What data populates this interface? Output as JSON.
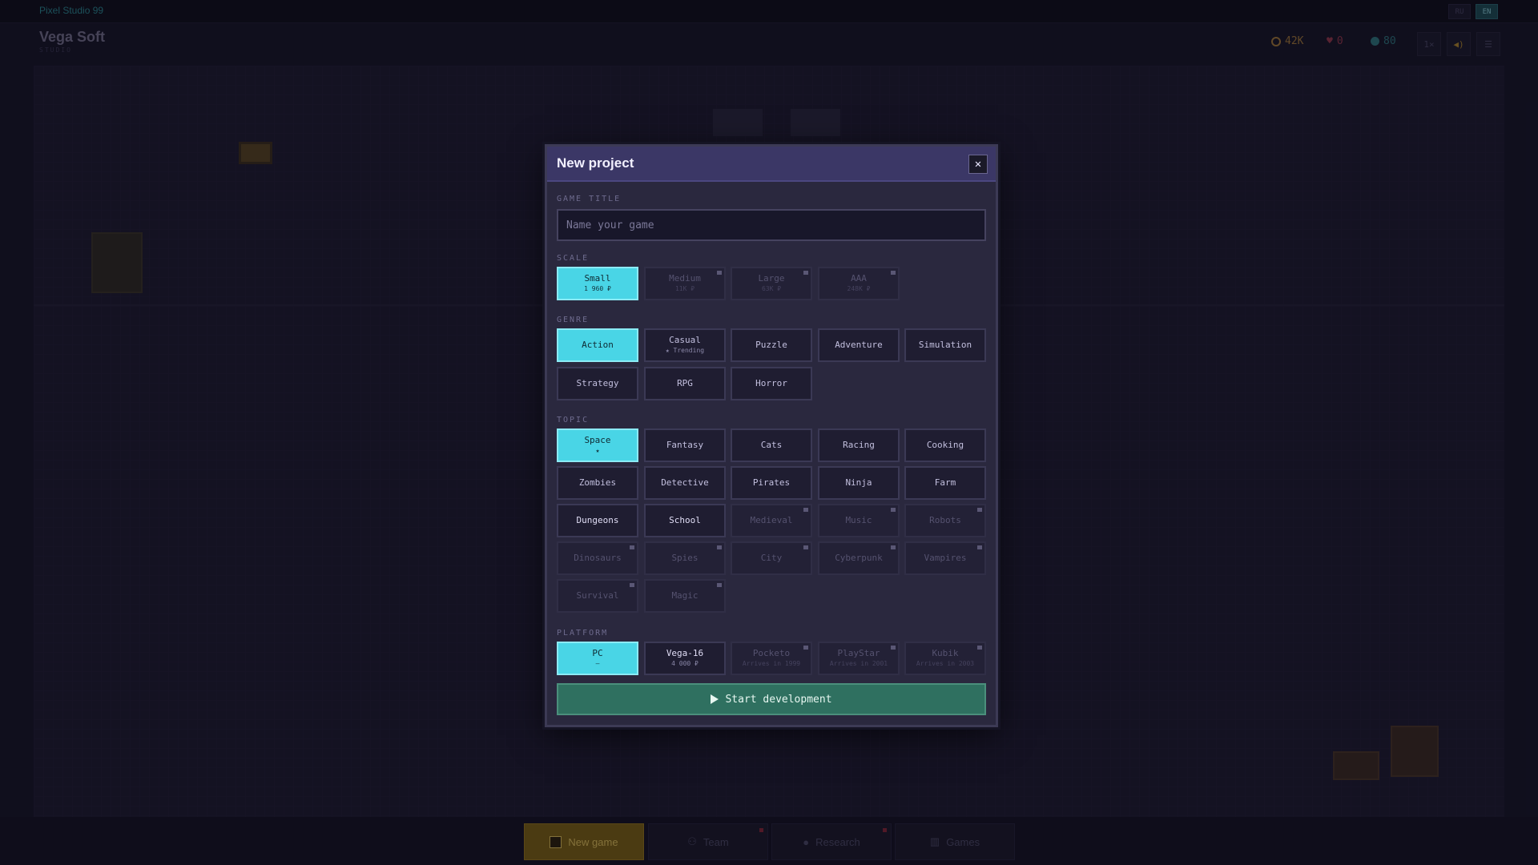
{
  "app": {
    "name": "Pixel Studio 99",
    "languages": [
      "RU",
      "EN"
    ],
    "active_language": "EN"
  },
  "studio": {
    "name": "Vega Soft",
    "subtitle": "STUDIO"
  },
  "stats": {
    "money": "42K",
    "fans": "0",
    "research": "80",
    "speed": "1×"
  },
  "bottom_nav": [
    {
      "label": "New game",
      "icon": "floppy-disk-icon",
      "active": true,
      "badge": false
    },
    {
      "label": "Team",
      "icon": "team-icon",
      "active": false,
      "badge": true
    },
    {
      "label": "Research",
      "icon": "bulb-icon",
      "active": false,
      "badge": true
    },
    {
      "label": "Games",
      "icon": "bar-chart-icon",
      "active": false,
      "badge": false
    }
  ],
  "modal": {
    "title": "New project",
    "close_label": "✕",
    "game_title": {
      "label": "GAME TITLE",
      "placeholder": "Name your game",
      "value": ""
    },
    "scale": {
      "label": "SCALE",
      "options": [
        {
          "name": "Small",
          "sub": "1 960 ₽",
          "state": "selected"
        },
        {
          "name": "Medium",
          "sub": "11K ₽",
          "state": "locked"
        },
        {
          "name": "Large",
          "sub": "63K ₽",
          "state": "locked"
        },
        {
          "name": "AAA",
          "sub": "248K ₽",
          "state": "locked"
        }
      ]
    },
    "genre": {
      "label": "GENRE",
      "options": [
        {
          "name": "Action",
          "sub": "",
          "state": "selected"
        },
        {
          "name": "Casual",
          "sub": "★ Trending",
          "state": "normal"
        },
        {
          "name": "Puzzle",
          "sub": "",
          "state": "normal"
        },
        {
          "name": "Adventure",
          "sub": "",
          "state": "normal"
        },
        {
          "name": "Simulation",
          "sub": "",
          "state": "normal"
        },
        {
          "name": "Strategy",
          "sub": "",
          "state": "normal"
        },
        {
          "name": "RPG",
          "sub": "",
          "state": "normal"
        },
        {
          "name": "Horror",
          "sub": "",
          "state": "normal"
        }
      ]
    },
    "topic": {
      "label": "TOPIC",
      "options": [
        {
          "name": "Space",
          "sub": "★",
          "state": "selected"
        },
        {
          "name": "Fantasy",
          "sub": "",
          "state": "normal"
        },
        {
          "name": "Cats",
          "sub": "",
          "state": "normal"
        },
        {
          "name": "Racing",
          "sub": "",
          "state": "normal"
        },
        {
          "name": "Cooking",
          "sub": "",
          "state": "normal"
        },
        {
          "name": "Zombies",
          "sub": "",
          "state": "normal"
        },
        {
          "name": "Detective",
          "sub": "",
          "state": "normal"
        },
        {
          "name": "Pirates",
          "sub": "",
          "state": "normal"
        },
        {
          "name": "Ninja",
          "sub": "",
          "state": "normal"
        },
        {
          "name": "Farm",
          "sub": "",
          "state": "normal"
        },
        {
          "name": "Dungeons",
          "sub": "",
          "state": "bright"
        },
        {
          "name": "School",
          "sub": "",
          "state": "bright"
        },
        {
          "name": "Medieval",
          "sub": "",
          "state": "locked"
        },
        {
          "name": "Music",
          "sub": "",
          "state": "locked"
        },
        {
          "name": "Robots",
          "sub": "",
          "state": "locked"
        },
        {
          "name": "Dinosaurs",
          "sub": "",
          "state": "locked"
        },
        {
          "name": "Spies",
          "sub": "",
          "state": "locked"
        },
        {
          "name": "City",
          "sub": "",
          "state": "locked"
        },
        {
          "name": "Cyberpunk",
          "sub": "",
          "state": "locked"
        },
        {
          "name": "Vampires",
          "sub": "",
          "state": "locked"
        },
        {
          "name": "Survival",
          "sub": "",
          "state": "locked"
        },
        {
          "name": "Magic",
          "sub": "",
          "state": "locked"
        }
      ]
    },
    "platform": {
      "label": "PLATFORM",
      "options": [
        {
          "name": "PC",
          "sub": "–",
          "state": "selected"
        },
        {
          "name": "Vega-16",
          "sub": "4 000 ₽",
          "state": "bright"
        },
        {
          "name": "Pocketo",
          "sub": "Arrives in 1999",
          "state": "locked"
        },
        {
          "name": "PlayStar",
          "sub": "Arrives in 2001",
          "state": "locked"
        },
        {
          "name": "Kubik",
          "sub": "Arrives in 2003",
          "state": "locked"
        }
      ]
    },
    "start_label": "Start development"
  },
  "colors": {
    "accent_selected": "#49d5e6",
    "start_button": "#2f7060",
    "new_game_button": "#806412",
    "header": "#3b3766"
  }
}
